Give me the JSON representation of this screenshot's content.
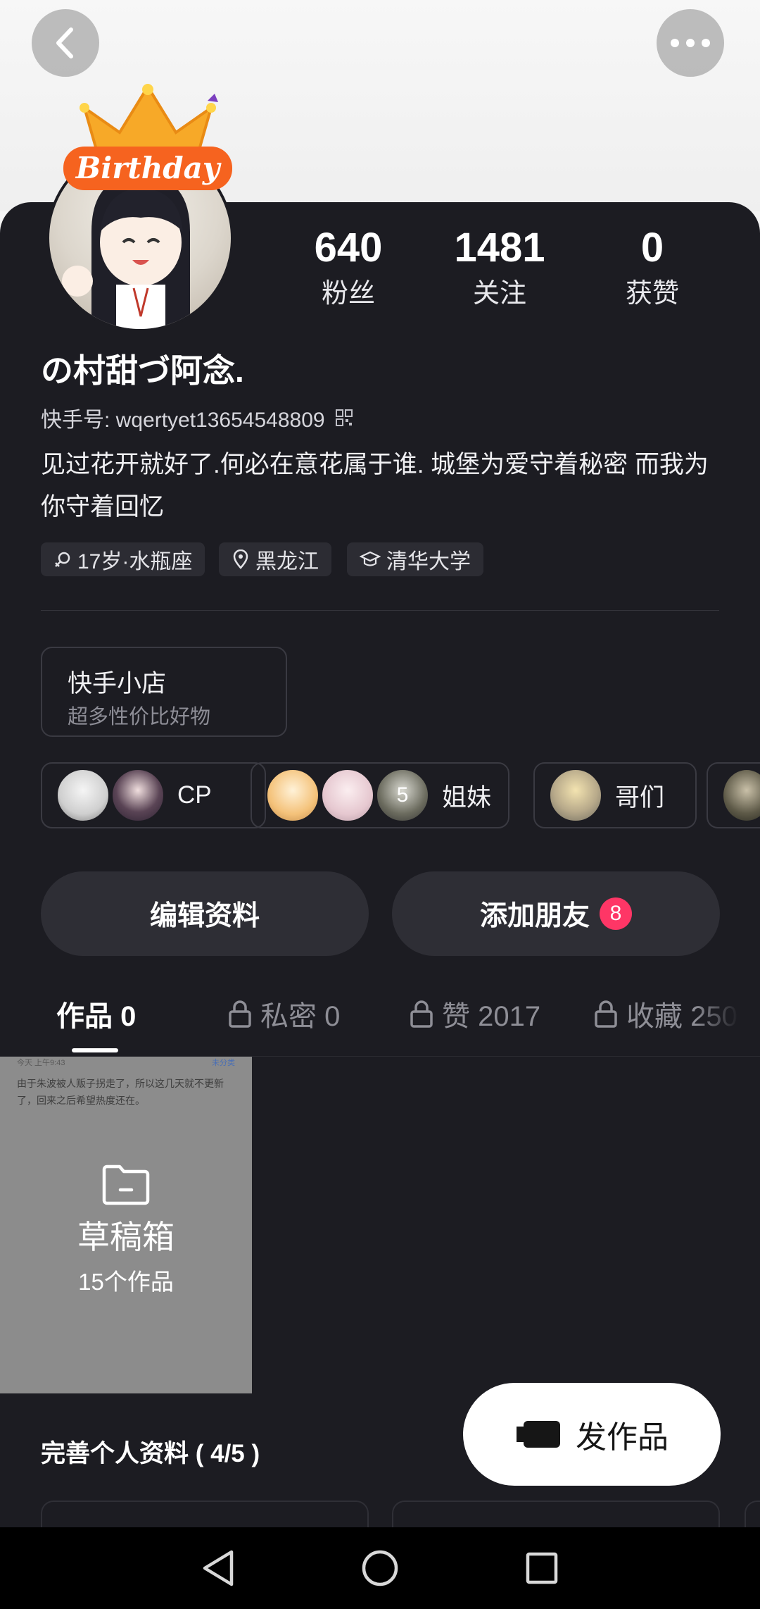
{
  "header": {
    "back_icon": "chevron-left-icon",
    "more_icon": "more-horizontal-icon",
    "birthday_text": "Birthday"
  },
  "stats": [
    {
      "value": "640",
      "label": "粉丝"
    },
    {
      "value": "1481",
      "label": "关注"
    },
    {
      "value": "0",
      "label": "获赞"
    }
  ],
  "profile": {
    "name": "の村甜づ阿念.",
    "kuaishou_id": "快手号: wqertyet13654548809",
    "bio": "见过花开就好了.何必在意花属于谁. 城堡为爱守着秘密 而我为你守着回忆"
  },
  "chips": {
    "age": "17岁·水瓶座",
    "location": "黑龙江",
    "school": "清华大学"
  },
  "shop": {
    "title": "快手小店",
    "subtitle": "超多性价比好物"
  },
  "groups": {
    "cp": "CP",
    "sisters_count": "5",
    "sisters": "姐妹",
    "brothers": "哥们"
  },
  "actions": {
    "edit": "编辑资料",
    "add_friend": "添加朋友",
    "add_friend_badge": "8"
  },
  "tabs": {
    "works": "作品 0",
    "private": "私密 0",
    "likes": "赞 2017",
    "favorites": "收藏 250"
  },
  "draft": {
    "meta_left": "今天 上午9:43",
    "meta_right": "未分类",
    "note": "由于朱波被人贩子拐走了，所以这几天就不更新了，回来之后希望热度还在。",
    "title": "草稿箱",
    "count": "15个作品"
  },
  "complete_profile": "完善个人资料 ( 4/5 )",
  "post_button": "发作品",
  "colors": {
    "panel": "#1c1c22",
    "badge": "#fe3666",
    "button_bg": "#2e2e35"
  }
}
